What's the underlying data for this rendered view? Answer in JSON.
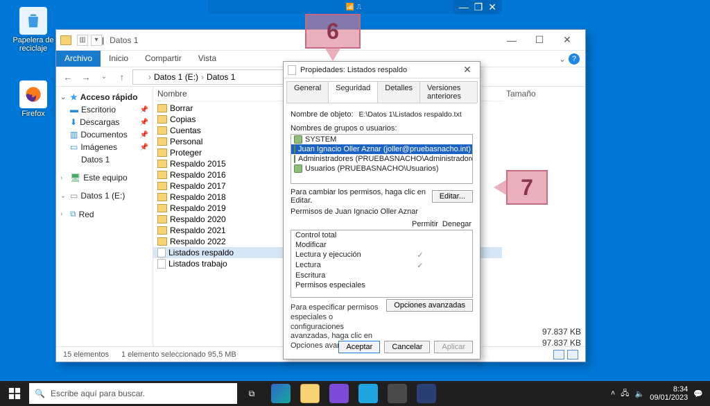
{
  "desktop": {
    "recycle": "Papelera de reciclaje",
    "firefox": "Firefox"
  },
  "explorer": {
    "title": "Datos 1",
    "ribbon": {
      "file": "Archivo",
      "home": "Inicio",
      "share": "Compartir",
      "view": "Vista"
    },
    "crumbs": [
      "Datos 1 (E:)",
      "Datos 1"
    ],
    "sep": "›",
    "nav": {
      "quick": "Acceso rápido",
      "desktop": "Escritorio",
      "downloads": "Descargas",
      "documents": "Documentos",
      "pictures": "Imágenes",
      "datos1": "Datos 1",
      "thispc": "Este equipo",
      "drive": "Datos 1 (E:)",
      "network": "Red"
    },
    "columns": {
      "name": "Nombre",
      "size": "Tamaño"
    },
    "items": [
      {
        "n": "Borrar",
        "t": "folder"
      },
      {
        "n": "Copias",
        "t": "folder"
      },
      {
        "n": "Cuentas",
        "t": "folder"
      },
      {
        "n": "Personal",
        "t": "folder"
      },
      {
        "n": "Proteger",
        "t": "folder"
      },
      {
        "n": "Respaldo 2015",
        "t": "folder"
      },
      {
        "n": "Respaldo 2016",
        "t": "folder"
      },
      {
        "n": "Respaldo 2017",
        "t": "folder"
      },
      {
        "n": "Respaldo 2018",
        "t": "folder"
      },
      {
        "n": "Respaldo 2019",
        "t": "folder"
      },
      {
        "n": "Respaldo 2020",
        "t": "folder"
      },
      {
        "n": "Respaldo 2021",
        "t": "folder"
      },
      {
        "n": "Respaldo 2022",
        "t": "folder"
      },
      {
        "n": "Listados respaldo",
        "t": "file",
        "sel": true
      },
      {
        "n": "Listados trabajo",
        "t": "file"
      }
    ],
    "right_sizes": [
      "97.837 KB",
      "97.837 KB"
    ],
    "status_left": "15 elementos",
    "status_sel": "1 elemento seleccionado  95,5 MB"
  },
  "props": {
    "title": "Propiedades: Listados respaldo",
    "tabs": {
      "general": "General",
      "security": "Seguridad",
      "details": "Detalles",
      "prev": "Versiones anteriores"
    },
    "obj_label": "Nombre de objeto:",
    "obj_value": "E:\\Datos 1\\Listados respaldo.txt",
    "groups_label": "Nombres de grupos o usuarios:",
    "groups": [
      {
        "n": "SYSTEM"
      },
      {
        "n": "Juan Ignacio Oller Aznar (joller@pruebasnacho.int)",
        "sel": true
      },
      {
        "n": "Administradores (PRUEBASNACHO\\Administradores)"
      },
      {
        "n": "Usuarios (PRUEBASNACHO\\Usuarios)"
      }
    ],
    "edit_hint": "Para cambiar los permisos, haga clic en Editar.",
    "edit_btn": "Editar...",
    "perms_for": "Permisos de Juan Ignacio Oller Aznar",
    "col_allow": "Permitir",
    "col_deny": "Denegar",
    "perms": [
      {
        "n": "Control total",
        "a": false
      },
      {
        "n": "Modificar",
        "a": false
      },
      {
        "n": "Lectura y ejecución",
        "a": true
      },
      {
        "n": "Lectura",
        "a": true
      },
      {
        "n": "Escritura",
        "a": false
      },
      {
        "n": "Permisos especiales",
        "a": false
      }
    ],
    "adv_note": "Para especificar permisos especiales o configuraciones avanzadas, haga clic en Opciones avanzadas.",
    "adv_btn": "Opciones avanzadas",
    "ok": "Aceptar",
    "cancel": "Cancelar",
    "apply": "Aplicar"
  },
  "annotations": {
    "a6": "6",
    "a7": "7"
  },
  "taskbar": {
    "search_placeholder": "Escribe aquí para buscar.",
    "time": "8:34",
    "date": "09/01/2023"
  }
}
